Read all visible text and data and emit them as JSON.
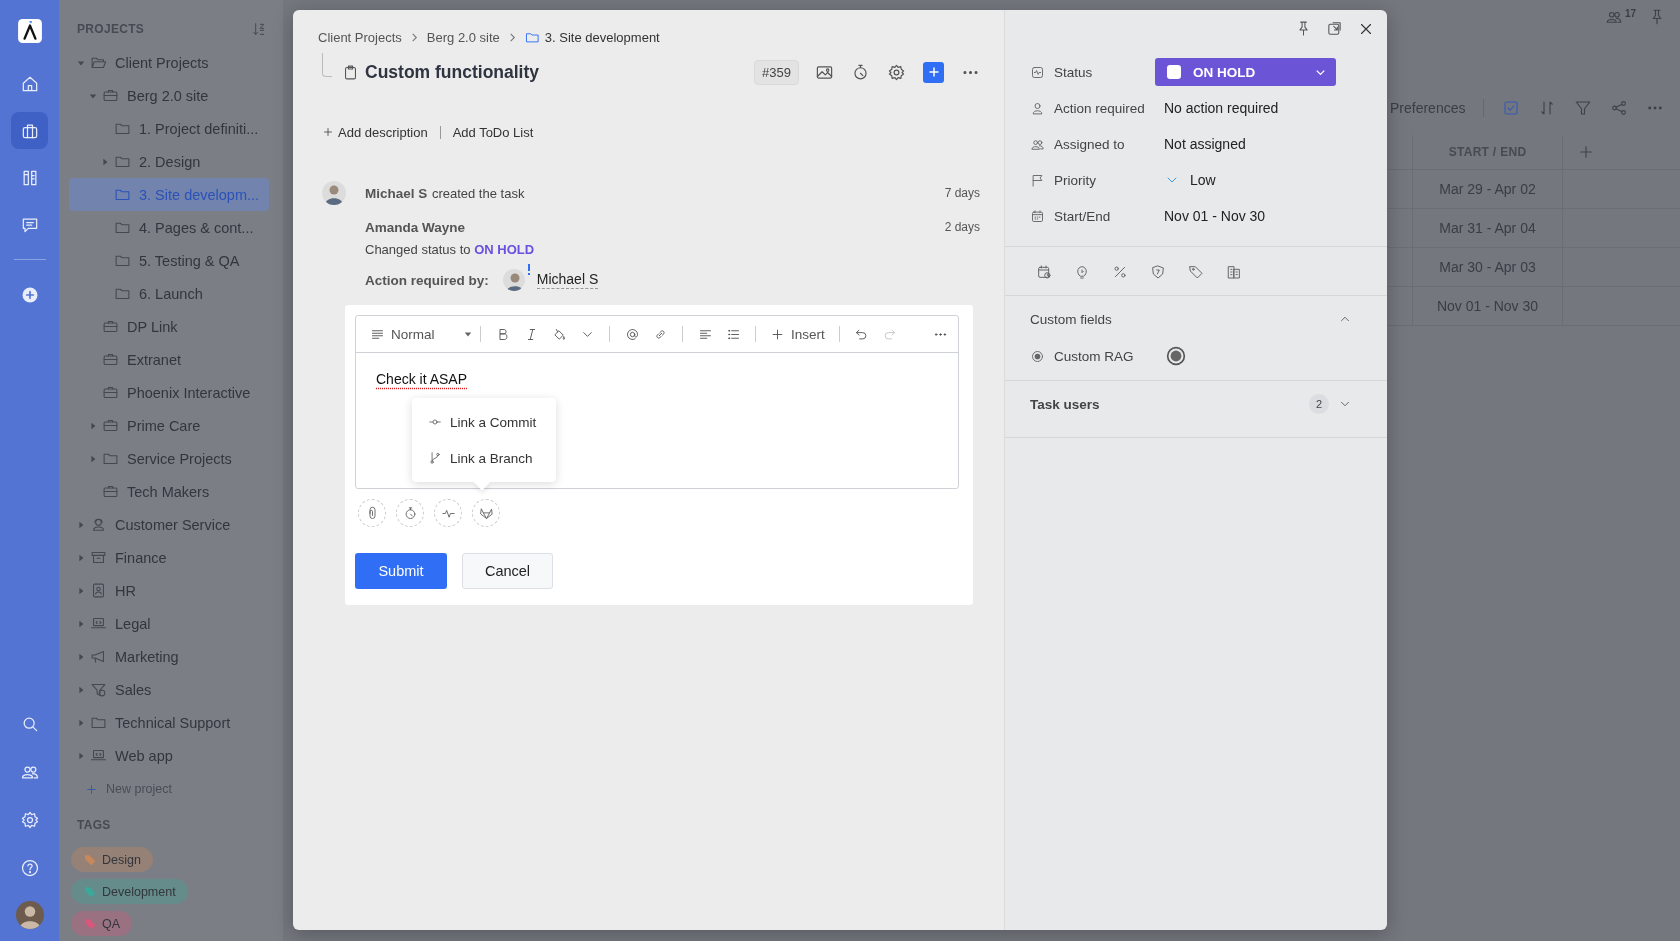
{
  "rail": {
    "top": [
      {
        "kind": "logo"
      },
      {
        "kind": "home",
        "selected": false
      },
      {
        "kind": "projects",
        "selected": true
      },
      {
        "kind": "tools",
        "selected": false
      },
      {
        "kind": "chat",
        "selected": false
      },
      {
        "kind": "add",
        "selected": false
      }
    ],
    "bottom": [
      {
        "kind": "search",
        "selected": false
      },
      {
        "kind": "people",
        "selected": false
      },
      {
        "kind": "settings",
        "selected": false
      },
      {
        "kind": "help",
        "selected": false
      },
      {
        "kind": "avatar"
      }
    ]
  },
  "sidebar": {
    "heading": "PROJECTS",
    "tree": [
      {
        "label": "Client Projects",
        "kind": "folder-open",
        "expanded": true,
        "selected": false,
        "children": [
          {
            "label": "Berg 2.0 site",
            "kind": "project",
            "expanded": true,
            "selected": false,
            "children": [
              {
                "label": "1. Project definiti...",
                "kind": "folder",
                "selected": false
              },
              {
                "label": "2. Design",
                "kind": "folder",
                "expanded": false,
                "selected": false
              },
              {
                "label": "3. Site developm...",
                "kind": "folder",
                "selected": true
              },
              {
                "label": "4. Pages & cont...",
                "kind": "folder",
                "selected": false
              },
              {
                "label": "5. Testing & QA",
                "kind": "folder",
                "selected": false
              },
              {
                "label": "6. Launch",
                "kind": "folder",
                "selected": false
              }
            ]
          },
          {
            "label": "DP Link",
            "kind": "project",
            "selected": false
          },
          {
            "label": "Extranet",
            "kind": "project",
            "selected": false
          },
          {
            "label": "Phoenix Interactive",
            "kind": "project",
            "selected": false
          },
          {
            "label": "Prime Care",
            "kind": "project",
            "expanded": false,
            "selected": false
          },
          {
            "label": "Service Projects",
            "kind": "folder",
            "expanded": false,
            "selected": false
          },
          {
            "label": "Tech Makers",
            "kind": "project",
            "selected": false
          }
        ]
      },
      {
        "label": "Customer Service",
        "kind": "support",
        "expanded": false,
        "selected": false
      },
      {
        "label": "Finance",
        "kind": "archive",
        "expanded": false,
        "selected": false
      },
      {
        "label": "HR",
        "kind": "contacts",
        "expanded": false,
        "selected": false
      },
      {
        "label": "Legal",
        "kind": "laptop",
        "expanded": false,
        "selected": false
      },
      {
        "label": "Marketing",
        "kind": "megaphone",
        "expanded": false,
        "selected": false
      },
      {
        "label": "Sales",
        "kind": "funnel",
        "expanded": false,
        "selected": false
      },
      {
        "label": "Technical Support",
        "kind": "folder",
        "expanded": false,
        "selected": false
      },
      {
        "label": "Web app",
        "kind": "laptop",
        "expanded": false,
        "selected": false
      }
    ],
    "new_project": "New project",
    "tags_heading": "TAGS",
    "tags": [
      {
        "label": "Design",
        "color": "#c9885a"
      },
      {
        "label": "Development",
        "color": "#3aa99a"
      },
      {
        "label": "QA",
        "color": "#d9577a"
      }
    ]
  },
  "background": {
    "online_count": "17",
    "toolbar": {
      "label": "Preferences"
    },
    "table": {
      "columns": [
        "START / END"
      ],
      "rows": [
        [
          "Mar 29 - Apr 02"
        ],
        [
          "Mar 31 - Apr 04"
        ],
        [
          "Mar 30 - Apr 03"
        ],
        [
          "Nov 01 - Nov 30"
        ]
      ]
    }
  },
  "task": {
    "breadcrumb": [
      {
        "label": "Client Projects",
        "kind": "text"
      },
      {
        "label": "Berg 2.0 site",
        "kind": "text"
      },
      {
        "label": "3. Site development",
        "kind": "folder"
      }
    ],
    "title": "Custom functionality",
    "number": "#359",
    "add_description": "Add description",
    "add_todo": "Add ToDo List",
    "activity": [
      {
        "author": "Michael S",
        "text": "created the task",
        "time": "7 days"
      },
      {
        "author": "Amanda Wayne",
        "time": "2 days",
        "change": "Changed status to **ON HOLD**",
        "action_label": "Action required by:",
        "action_user": "Michael S"
      }
    ],
    "editor": {
      "toolbar": [
        {
          "kind": "style",
          "label": "Normal"
        },
        {
          "kind": "separator"
        },
        {
          "kind": "bold"
        },
        {
          "kind": "italic"
        },
        {
          "kind": "paint"
        },
        {
          "kind": "chevron"
        },
        {
          "kind": "separator"
        },
        {
          "kind": "mention"
        },
        {
          "kind": "link"
        },
        {
          "kind": "separator"
        },
        {
          "kind": "align"
        },
        {
          "kind": "list"
        },
        {
          "kind": "separator"
        },
        {
          "kind": "insert",
          "label": "Insert"
        },
        {
          "kind": "separator"
        },
        {
          "kind": "undo",
          "disabled": false
        },
        {
          "kind": "redo",
          "disabled": true
        },
        {
          "kind": "more"
        }
      ],
      "text": "Check it ASAP",
      "menu": [
        {
          "kind": "commit",
          "label": "Link a Commit"
        },
        {
          "kind": "branch",
          "label": "Link a Branch"
        }
      ],
      "attachments": [
        {
          "kind": "attach"
        },
        {
          "kind": "timer"
        },
        {
          "kind": "pulse"
        },
        {
          "kind": "fox"
        }
      ],
      "submit": "Submit",
      "cancel": "Cancel"
    }
  },
  "details": {
    "fields": [
      {
        "kind": "status",
        "label": "Status",
        "value": "ON HOLD"
      },
      {
        "kind": "person",
        "label": "Action required",
        "value": "No action required"
      },
      {
        "kind": "people",
        "label": "Assigned to",
        "value": "Not assigned"
      },
      {
        "kind": "priority",
        "label": "Priority",
        "value": "Low"
      },
      {
        "kind": "dates",
        "label": "Start/End",
        "value": "Nov 01 - Nov 30"
      }
    ],
    "tools": [
      {
        "kind": "calendar"
      },
      {
        "kind": "bulb"
      },
      {
        "kind": "percent"
      },
      {
        "kind": "shield"
      },
      {
        "kind": "tag"
      },
      {
        "kind": "building"
      }
    ],
    "custom_fields": {
      "title": "Custom fields",
      "expanded": true,
      "items": [
        {
          "label": "Custom RAG"
        }
      ]
    },
    "task_users": {
      "title": "Task users",
      "count": "2",
      "expanded": false
    }
  }
}
